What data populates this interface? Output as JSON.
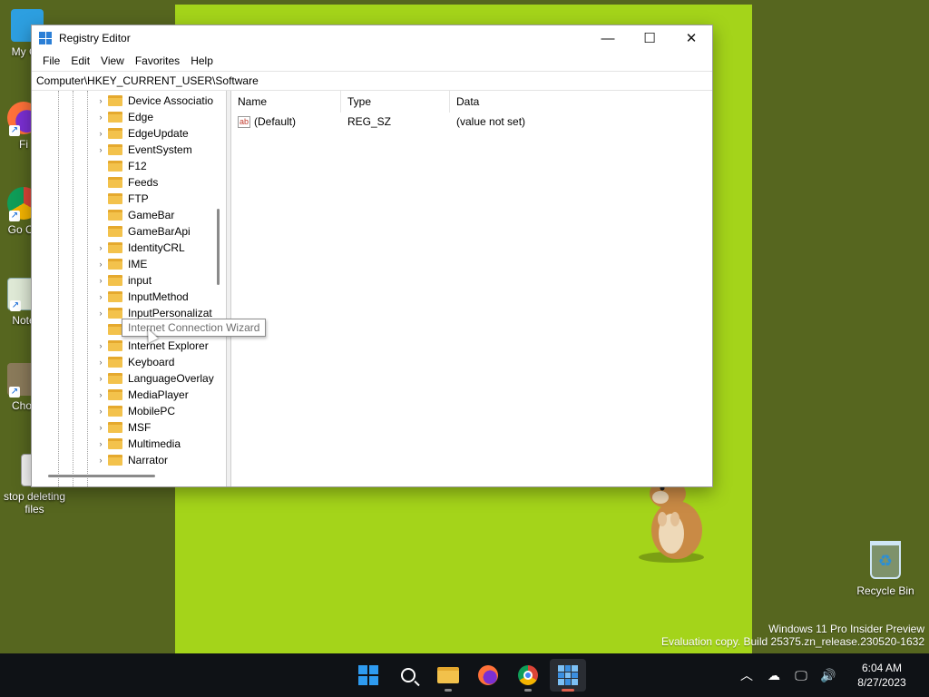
{
  "desktop": {
    "icons": [
      {
        "label": "My Co",
        "glyph": "▭"
      },
      {
        "label": "Fi",
        "glyph": "●"
      },
      {
        "label": "Go Ch",
        "glyph": "◉"
      },
      {
        "label": "Note",
        "glyph": "✎"
      },
      {
        "label": "Chor",
        "glyph": "◆"
      },
      {
        "label": "stop deleting files",
        "glyph": "▤"
      }
    ],
    "recycle_bin": {
      "label": "Recycle Bin",
      "glyph": "♻"
    },
    "watermark": {
      "line1": "Windows 11 Pro Insider Preview",
      "line2": "Evaluation copy. Build 25375.zn_release.230520-1632"
    }
  },
  "window": {
    "title": "Registry Editor",
    "controls": {
      "minimize": "—",
      "maximize": "☐",
      "close": "✕"
    },
    "menu": [
      "File",
      "Edit",
      "View",
      "Favorites",
      "Help"
    ],
    "address": "Computer\\HKEY_CURRENT_USER\\Software",
    "tree": {
      "items": [
        {
          "label": "Device Associatio",
          "expandable": true
        },
        {
          "label": "Edge",
          "expandable": true
        },
        {
          "label": "EdgeUpdate",
          "expandable": true
        },
        {
          "label": "EventSystem",
          "expandable": true
        },
        {
          "label": "F12",
          "expandable": false
        },
        {
          "label": "Feeds",
          "expandable": false
        },
        {
          "label": "FTP",
          "expandable": false
        },
        {
          "label": "GameBar",
          "expandable": false
        },
        {
          "label": "GameBarApi",
          "expandable": false
        },
        {
          "label": "IdentityCRL",
          "expandable": true
        },
        {
          "label": "IME",
          "expandable": true
        },
        {
          "label": "input",
          "expandable": true
        },
        {
          "label": "InputMethod",
          "expandable": true
        },
        {
          "label": "InputPersonalizat",
          "expandable": true
        },
        {
          "label": "Internet Connection Wizard",
          "expandable": false
        },
        {
          "label": "Internet Explorer",
          "expandable": true
        },
        {
          "label": "Keyboard",
          "expandable": true
        },
        {
          "label": "LanguageOverlay",
          "expandable": true
        },
        {
          "label": "MediaPlayer",
          "expandable": true
        },
        {
          "label": "MobilePC",
          "expandable": true
        },
        {
          "label": "MSF",
          "expandable": true
        },
        {
          "label": "Multimedia",
          "expandable": true
        },
        {
          "label": "Narrator",
          "expandable": true
        }
      ],
      "tooltip": "Internet Connection Wizard"
    },
    "list": {
      "columns": [
        "Name",
        "Type",
        "Data"
      ],
      "rows": [
        {
          "icon": "ab",
          "name": "(Default)",
          "type": "REG_SZ",
          "data": "(value not set)"
        }
      ]
    }
  },
  "taskbar": {
    "apps": [
      "start-button",
      "search-button",
      "file-explorer",
      "firefox",
      "chrome",
      "registry-editor"
    ],
    "tray": {
      "chevron": "︿",
      "network_off": "☁",
      "display": "🖵",
      "volume": "🔊"
    },
    "clock": {
      "time": "6:04 AM",
      "date": "8/27/2023"
    }
  },
  "colors": {
    "wallpaper": "#a4d41a",
    "desktop_bg": "#56661f",
    "taskbar": "#0f1216",
    "folder": "#f3c24c",
    "active_indicator": "#e0604e"
  }
}
